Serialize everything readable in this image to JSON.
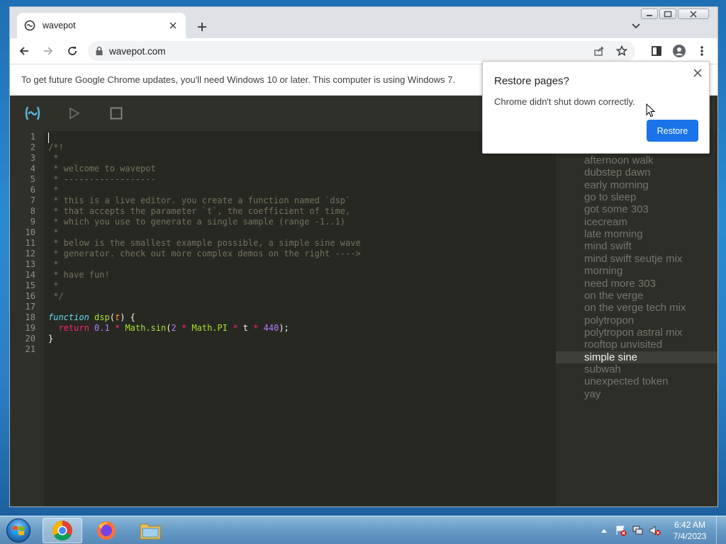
{
  "browser": {
    "tab_title": "wavepot",
    "url": "wavepot.com",
    "infobar_text": "To get future Google Chrome updates, you'll need Windows 10 or later. This computer is using Windows 7."
  },
  "restore_popup": {
    "title": "Restore pages?",
    "message": "Chrome didn't shut down correctly.",
    "button_label": "Restore"
  },
  "editor": {
    "line_numbers": [
      "1",
      "2",
      "3",
      "4",
      "5",
      "6",
      "7",
      "8",
      "9",
      "10",
      "11",
      "12",
      "13",
      "14",
      "15",
      "16",
      "17",
      "18",
      "19",
      "20",
      "21"
    ],
    "comment_lines": [
      "/*!",
      " *",
      " * welcome to wavepot",
      " * ------------------",
      " *",
      " * this is a live editor. you create a function named `dsp`",
      " * that accepts the parameter `t`, the coefficient of time,",
      " * which you use to generate a single sample (range -1..1)",
      " *",
      " * below is the smallest example possible, a simple sine wave",
      " * generator. check out more complex demos on the right ---->",
      " *",
      " * have fun!",
      " *",
      " */"
    ],
    "code": {
      "kw_function": "function",
      "fn_name": "dsp",
      "param": "t",
      "kw_return": "return",
      "amp": "0.1",
      "math_sin": "Math.sin",
      "two": "2",
      "math_pi": "Math.PI",
      "t": "t",
      "freq": "440"
    }
  },
  "demos": {
    "items": [
      "afternoon walk",
      "dubstep dawn",
      "early morning",
      "go to sleep",
      "got some 303",
      "icecream",
      "late morning",
      "mind swift",
      "mind swift seutje mix",
      "morning",
      "need more 303",
      "on the verge",
      "on the verge tech mix",
      "polytropon",
      "polytropon astral mix",
      "rooftop unvisited",
      "simple sine",
      "subwah",
      "unexpected token",
      "yay"
    ],
    "selected": "simple sine"
  },
  "taskbar": {
    "time": "6:42 AM",
    "date": "7/4/2023"
  }
}
